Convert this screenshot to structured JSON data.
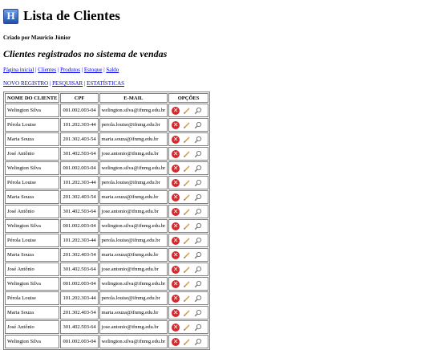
{
  "header": {
    "logo_letter": "H",
    "title": "Lista de Clientes",
    "byline": "Criado por Mauricio Júnior",
    "subtitle": "Clientes registrados no sistema de vendas"
  },
  "nav": [
    {
      "label": "Página inicial"
    },
    {
      "label": "Clientes"
    },
    {
      "label": "Produtos"
    },
    {
      "label": "Estoque"
    },
    {
      "label": "Saldo"
    }
  ],
  "actions": [
    {
      "label": "NOVO REGISTRO"
    },
    {
      "label": "PESQUISAR"
    },
    {
      "label": "ESTATÍSTICAS"
    }
  ],
  "table": {
    "headers": [
      "NOME DO CLIENTE",
      "CPF",
      "E-MAIL",
      "OPÇÕES"
    ],
    "rows": [
      {
        "name": "Welington Silva",
        "cpf": "001.002.003-04",
        "email": "welington.silva@ifnmg.edu.br"
      },
      {
        "name": "Pérola Louise",
        "cpf": "101.202.303-44",
        "email": "perola.louise@ifnmg.edu.br"
      },
      {
        "name": "Maria Souza",
        "cpf": "201.302.403-54",
        "email": "maria.souza@ifnmg.edu.br"
      },
      {
        "name": "José Antônio",
        "cpf": "301.402.503-64",
        "email": "jose.antonio@ifnmg.edu.br"
      },
      {
        "name": "Welington Silva",
        "cpf": "001.002.003-04",
        "email": "welington.silva@ifnmg.edu.br"
      },
      {
        "name": "Pérola Louise",
        "cpf": "101.202.303-44",
        "email": "perola.louise@ifnmg.edu.br"
      },
      {
        "name": "Maria Souza",
        "cpf": "201.302.403-54",
        "email": "maria.souza@ifnmg.edu.br"
      },
      {
        "name": "José Antônio",
        "cpf": "301.402.503-64",
        "email": "jose.antonio@ifnmg.edu.br"
      },
      {
        "name": "Welington Silva",
        "cpf": "001.002.003-04",
        "email": "welington.silva@ifnmg.edu.br"
      },
      {
        "name": "Pérola Louise",
        "cpf": "101.202.303-44",
        "email": "perola.louise@ifnmg.edu.br"
      },
      {
        "name": "Maria Souza",
        "cpf": "201.302.403-54",
        "email": "maria.souza@ifnmg.edu.br"
      },
      {
        "name": "José Antônio",
        "cpf": "301.402.503-64",
        "email": "jose.antonio@ifnmg.edu.br"
      },
      {
        "name": "Welington Silva",
        "cpf": "001.002.003-04",
        "email": "welington.silva@ifnmg.edu.br"
      },
      {
        "name": "Pérola Louise",
        "cpf": "101.202.303-44",
        "email": "perola.louise@ifnmg.edu.br"
      },
      {
        "name": "Maria Souza",
        "cpf": "201.302.403-54",
        "email": "maria.souza@ifnmg.edu.br"
      },
      {
        "name": "José Antônio",
        "cpf": "301.402.503-64",
        "email": "jose.antonio@ifnmg.edu.br"
      },
      {
        "name": "Welington Silva",
        "cpf": "001.002.003-04",
        "email": "welington.silva@ifnmg.edu.br"
      }
    ],
    "row_icons": [
      "delete-icon",
      "edit-pencil-icon",
      "view-magnifier-icon"
    ]
  },
  "colors": {
    "link": "#0000ee",
    "delete_icon": "#d8262a",
    "pencil": "#e8a23a",
    "border": "#808080"
  }
}
